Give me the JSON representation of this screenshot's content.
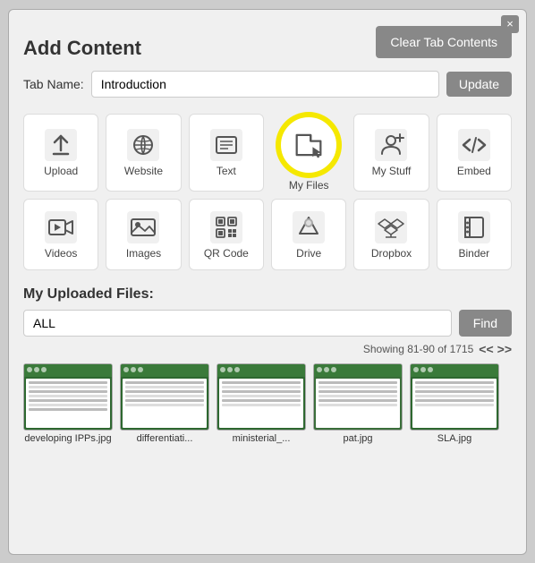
{
  "modal": {
    "close_label": "×",
    "title": "Add Content",
    "clear_btn": "Clear Tab Contents",
    "tab_name_label": "Tab Name:",
    "tab_name_value": "Introduction",
    "update_btn": "Update"
  },
  "icons": [
    {
      "id": "upload",
      "label": "Upload",
      "icon": "upload"
    },
    {
      "id": "website",
      "label": "Website",
      "icon": "link"
    },
    {
      "id": "text",
      "label": "Text",
      "icon": "text"
    },
    {
      "id": "myfiles",
      "label": "My Files",
      "icon": "myfiles",
      "highlighted": true
    },
    {
      "id": "mystuff",
      "label": "My Stuff",
      "icon": "mystuff"
    },
    {
      "id": "embed",
      "label": "Embed",
      "icon": "embed"
    },
    {
      "id": "videos",
      "label": "Videos",
      "icon": "videos"
    },
    {
      "id": "images",
      "label": "Images",
      "icon": "images"
    },
    {
      "id": "qrcode",
      "label": "QR Code",
      "icon": "qrcode"
    },
    {
      "id": "drive",
      "label": "Drive",
      "icon": "drive"
    },
    {
      "id": "dropbox",
      "label": "Dropbox",
      "icon": "dropbox"
    },
    {
      "id": "binder",
      "label": "Binder",
      "icon": "binder"
    }
  ],
  "my_files": {
    "title": "My Uploaded Files:",
    "search_value": "ALL",
    "find_btn": "Find",
    "showing": "Showing 81-90 of 1715",
    "prev": "<<",
    "next": ">>",
    "files": [
      {
        "name": "developing IPPs.jpg"
      },
      {
        "name": "differentiati..."
      },
      {
        "name": "ministerial_..."
      },
      {
        "name": "pat.jpg"
      },
      {
        "name": "SLA.jpg"
      }
    ]
  }
}
